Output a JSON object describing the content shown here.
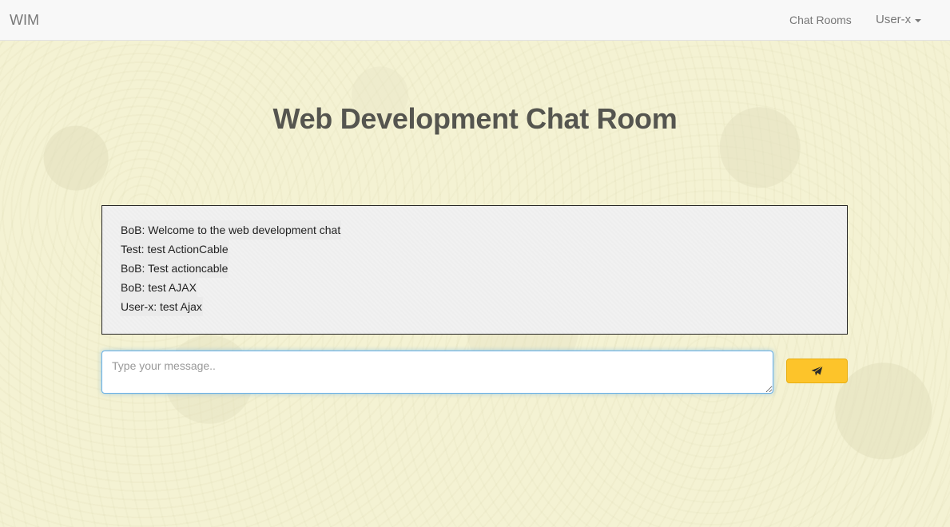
{
  "navbar": {
    "brand": "WIM",
    "links": [
      {
        "label": "Chat Rooms"
      }
    ],
    "user_menu": {
      "label": "User-x"
    }
  },
  "room": {
    "title": "Web Development Chat Room"
  },
  "messages": [
    {
      "text": "BoB: Welcome to the web development chat"
    },
    {
      "text": "Test: test ActionCable"
    },
    {
      "text": "BoB: Test actioncable"
    },
    {
      "text": "BoB: test AJAX"
    },
    {
      "text": "User-x: test Ajax"
    }
  ],
  "composer": {
    "value": "",
    "placeholder": "Type your message..",
    "send_icon": "paper-plane-icon",
    "send_color": "#fdc42a"
  }
}
